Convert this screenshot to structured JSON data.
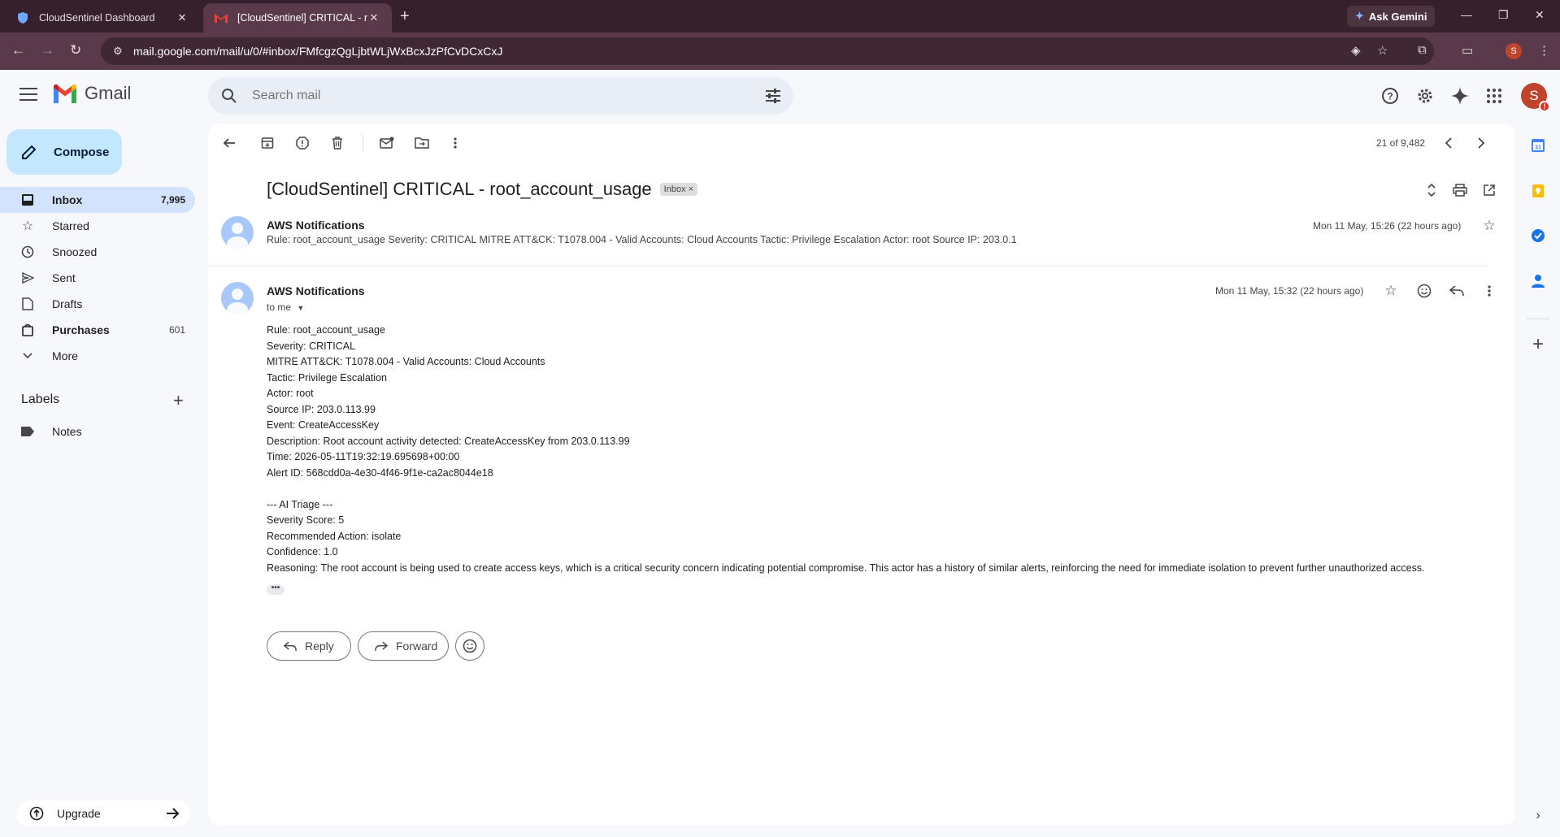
{
  "browser": {
    "tabs": [
      {
        "title": "CloudSentinel Dashboard"
      },
      {
        "title": "[CloudSentinel] CRITICAL - root_account_usage"
      }
    ],
    "gemini_label": "Ask Gemini",
    "url": "mail.google.com/mail/u/0/#inbox/FMfcgzQgLjbtWLjWxBcxJzPfCvDCxCxJ",
    "profile_initial": "S"
  },
  "header": {
    "logo_text": "Gmail",
    "search_placeholder": "Search mail",
    "avatar_initial": "S",
    "avatar_badge": "!"
  },
  "sidebar": {
    "compose_label": "Compose",
    "items": [
      {
        "label": "Inbox",
        "count": "7,995"
      },
      {
        "label": "Starred",
        "count": ""
      },
      {
        "label": "Snoozed",
        "count": ""
      },
      {
        "label": "Sent",
        "count": ""
      },
      {
        "label": "Drafts",
        "count": ""
      },
      {
        "label": "Purchases",
        "count": "601"
      },
      {
        "label": "More",
        "count": ""
      }
    ],
    "labels_heading": "Labels",
    "labels": [
      {
        "label": "Notes"
      }
    ],
    "upgrade_label": "Upgrade"
  },
  "message_view": {
    "pager_text": "21 of 9,482",
    "subject": "[CloudSentinel] CRITICAL - root_account_usage",
    "subject_chip": "Inbox",
    "collapsed": {
      "sender": "AWS Notifications",
      "date": "Mon 11 May, 15:26 (22 hours ago)",
      "snippet": "Rule: root_account_usage Severity: CRITICAL MITRE ATT&CK: T1078.004 - Valid Accounts: Cloud Accounts Tactic: Privilege Escalation Actor: root Source IP: 203.0.1"
    },
    "expanded": {
      "sender": "AWS Notifications",
      "to_label": "to me",
      "date": "Mon 11 May, 15:32 (22 hours ago)",
      "body_lines": [
        "Rule: root_account_usage",
        "Severity: CRITICAL",
        "MITRE ATT&CK: T1078.004 - Valid Accounts: Cloud Accounts",
        "Tactic: Privilege Escalation",
        "Actor: root",
        "Source IP: 203.0.113.99",
        "Event: CreateAccessKey",
        "Description: Root account activity detected: CreateAccessKey from 203.0.113.99",
        "Time: 2026-05-11T19:32:19.695698+00:00",
        "Alert ID: 568cdd0a-4e30-4f46-9f1e-ca2ac8044e18",
        "",
        "--- AI Triage ---",
        "Severity Score: 5",
        "Recommended Action: isolate",
        "Confidence: 1.0",
        "Reasoning: The root account is being used to create access keys, which is a critical security concern indicating potential compromise. This actor has a history of similar alerts, reinforcing the need for immediate isolation to prevent further unauthorized access."
      ],
      "ellipsis": "•••"
    },
    "reply_label": "Reply",
    "forward_label": "Forward"
  },
  "colors": {
    "chrome_dark": "#35202c",
    "chrome_toolbar": "#5a3a4a",
    "gmail_bg": "#f6f8fc",
    "compose_bg": "#c2e7ff",
    "inbox_active": "#d3e3fd",
    "avatar_red": "#c0442b"
  }
}
